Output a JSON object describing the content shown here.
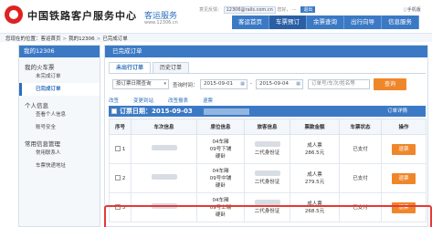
{
  "header": {
    "brand": "中国铁路客户服务中心",
    "brand_sub": "客运服务",
    "brand_url": "www.12306.cn",
    "user_label": "意见反馈：",
    "user_mail": "12306@rails.com.cn",
    "greeting": "您好，",
    "greeting_masked": "···",
    "logout": "退出",
    "mobile": "手机版"
  },
  "nav": [
    {
      "label": "客运首页",
      "active": false
    },
    {
      "label": "车票预订",
      "active": true
    },
    {
      "label": "余票查询",
      "active": false
    },
    {
      "label": "出行向导",
      "active": false
    },
    {
      "label": "信息服务",
      "active": false
    }
  ],
  "breadcrumb": {
    "prefix": "您现在的位置：",
    "items": [
      "客运首页",
      "我的12306",
      "已完成订单"
    ],
    "sep": ">"
  },
  "sidebar": {
    "title": "我的12306",
    "groups": [
      {
        "label": "我的火车票",
        "items": [
          {
            "label": "未完成订单",
            "active": false
          },
          {
            "label": "已完成订单",
            "active": true
          }
        ]
      },
      {
        "label": "个人信息",
        "items": [
          {
            "label": "查看个人信息",
            "active": false
          },
          {
            "label": "账号安全",
            "active": false
          }
        ]
      },
      {
        "label": "常用信息管理",
        "items": [
          {
            "label": "常用联系人",
            "active": false
          },
          {
            "label": "车票快递地址",
            "active": false
          }
        ]
      }
    ]
  },
  "main": {
    "title": "已完成订单",
    "tabs": [
      {
        "label": "未出行订单",
        "active": true
      },
      {
        "label": "历史订单",
        "active": false
      }
    ],
    "filter": {
      "type_value": "按订票日期查询",
      "range_label": "查询时间：",
      "date_from": "2015-09-01",
      "dash": "-",
      "date_to": "2015-09-04",
      "keyword_placeholder": "订单号/车次/姓名等",
      "query_label": "查询"
    },
    "ops": [
      "改签",
      "变更到站",
      "改签报表",
      "退票"
    ],
    "order": {
      "prefix": "订票日期：",
      "date": "2015-09-03",
      "detail": "订单详情"
    },
    "columns": [
      "序号",
      "车次信息",
      "席位信息",
      "旅客信息",
      "票款金额",
      "车票状态",
      "操作"
    ],
    "rows": [
      {
        "no": "1",
        "seat_line1": "04车厢",
        "seat_line2": "09号下铺",
        "seat_line3": "硬卧",
        "id_type": "二代身份证",
        "fare_type": "成人票",
        "fare": "286.5元",
        "status": "已支付",
        "action": "退票"
      },
      {
        "no": "2",
        "seat_line1": "04车厢",
        "seat_line2": "09号中铺",
        "seat_line3": "硬卧",
        "id_type": "二代身份证",
        "fare_type": "成人票",
        "fare": "279.5元",
        "status": "已支付",
        "action": "退票"
      },
      {
        "no": "3",
        "seat_line1": "04车厢",
        "seat_line2": "09号上铺",
        "seat_line3": "硬卧",
        "id_type": "二代身份证",
        "fare_type": "成人票",
        "fare": "268.5元",
        "status": "已支付",
        "action": "退票"
      }
    ]
  },
  "colors": {
    "primary": "#3b79c5",
    "accent": "#f0862a",
    "highlight": "#e53935",
    "brand_red": "#d22222"
  }
}
